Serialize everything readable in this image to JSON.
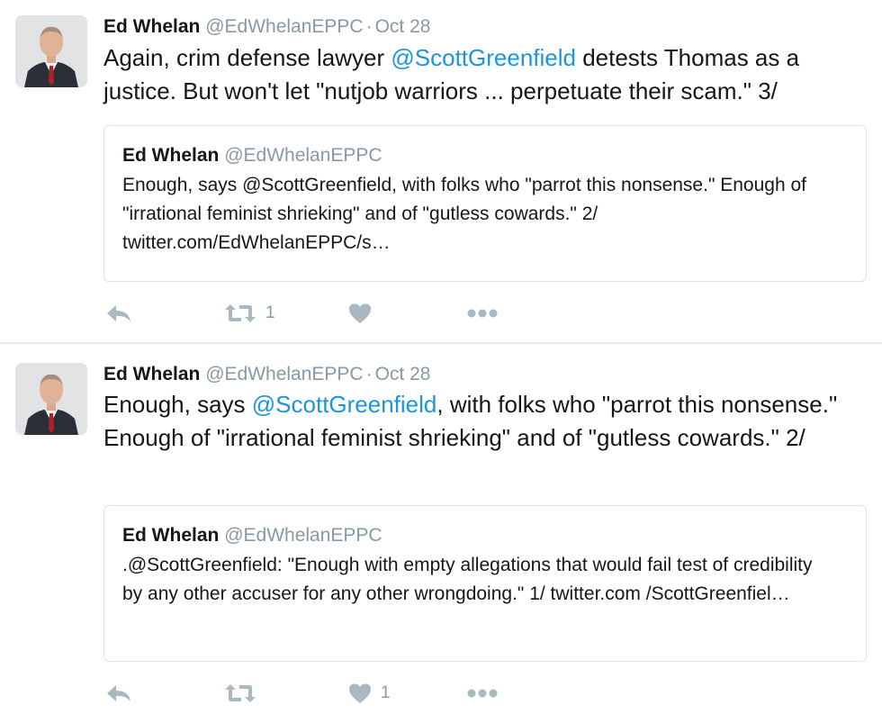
{
  "tweets": [
    {
      "author": {
        "name": "Ed Whelan",
        "handle": "@EdWhelanEPPC",
        "separator": "·",
        "date": "Oct 28"
      },
      "text": {
        "before": "Again, crim defense lawyer ",
        "mention": "@ScottGreenfield",
        "after": " detests Thomas as a justice. But won't let \"nutjob warriors ... perpetuate their scam.\" 3/"
      },
      "quote": {
        "name": "Ed Whelan",
        "handle": "@EdWhelanEPPC",
        "text": "Enough, says @ScottGreenfield, with folks who \"parrot this nonsense.\" Enough of \"irrational feminist shrieking\" and of \"gutless cowards.\" 2/ twitter.com/EdWhelanEPPC/s…"
      },
      "actions": {
        "retweet_count": "1",
        "like_count": ""
      }
    },
    {
      "author": {
        "name": "Ed Whelan",
        "handle": "@EdWhelanEPPC",
        "separator": "·",
        "date": "Oct 28"
      },
      "text": {
        "before": "Enough, says ",
        "mention": "@ScottGreenfield",
        "after": ", with folks who \"parrot this nonsense.\" Enough of \"irrational feminist shrieking\" and of \"gutless cowards.\" 2/"
      },
      "quote": {
        "name": "Ed Whelan",
        "handle": "@EdWhelanEPPC",
        "text": ".@ScottGreenfield: \"Enough with empty allegations that would fail test of credibility by any other accuser for any other wrongdoing.\" 1/ twitter.com /ScottGreenfiel…"
      },
      "actions": {
        "retweet_count": "",
        "like_count": "1"
      }
    }
  ],
  "icons": {
    "reply": "reply-icon",
    "retweet": "retweet-icon",
    "like": "heart-icon",
    "more": "more-icon"
  },
  "colors": {
    "link": "#1b95e0",
    "muted": "#8899a6",
    "icon": "#aab8c2",
    "border": "#dbe3e8"
  }
}
